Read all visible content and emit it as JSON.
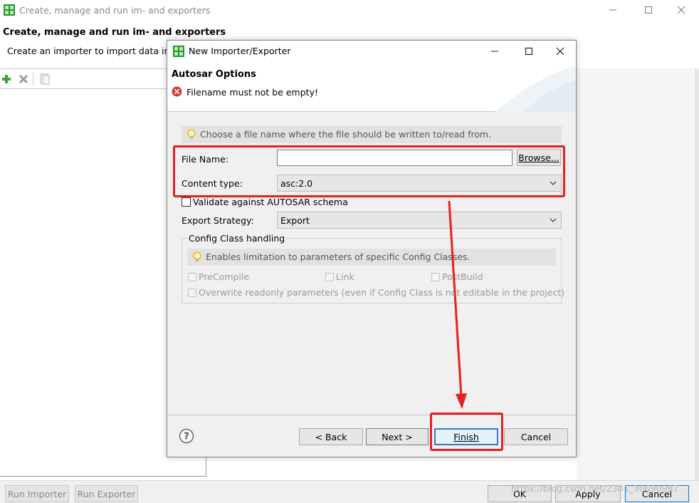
{
  "background_window": {
    "title": "Create, manage and run im- and exporters",
    "heading": "Create, manage and run im- and exporters",
    "subtext": "Create an importer to import data into",
    "buttons": {
      "run_importer": "Run Importer",
      "run_exporter": "Run Exporter",
      "ok": "OK",
      "apply": "Apply",
      "cancel": "Cancel"
    },
    "toolbar_icons": [
      "add-icon",
      "delete-icon",
      "copy-icon"
    ],
    "watermark": "https://blog.csdn.net/2301_30690987"
  },
  "dialog": {
    "title": "New Importer/Exporter",
    "page_title": "Autosar Options",
    "error_message": "Filename must not be empty!",
    "hint": "Choose a file name where the file should be written to/read from.",
    "file_name": {
      "label": "File Name:",
      "value": "",
      "browse_label": "Browse..."
    },
    "content_type": {
      "label": "Content type:",
      "value": "asc:2.0"
    },
    "validate": {
      "label": "Validate against AUTOSAR schema",
      "checked": false
    },
    "export_strategy": {
      "label": "Export Strategy:",
      "value": "Export"
    },
    "config_class": {
      "legend": "Config Class handling",
      "hint": "Enables limitation to parameters of specific Config Classes.",
      "options": {
        "precompile": "PreCompile",
        "link": "Link",
        "postbuild": "PostBuild",
        "overwrite": "Overwrite readonly parameters (even if Config Class is not editable in the project)"
      }
    },
    "buttons": {
      "back": "< Back",
      "next": "Next >",
      "finish": "Finish",
      "cancel": "Cancel"
    }
  },
  "colors": {
    "annotation_red": "#e62020",
    "focus_blue": "#2b7fd4",
    "error_red": "#d83b3b"
  }
}
